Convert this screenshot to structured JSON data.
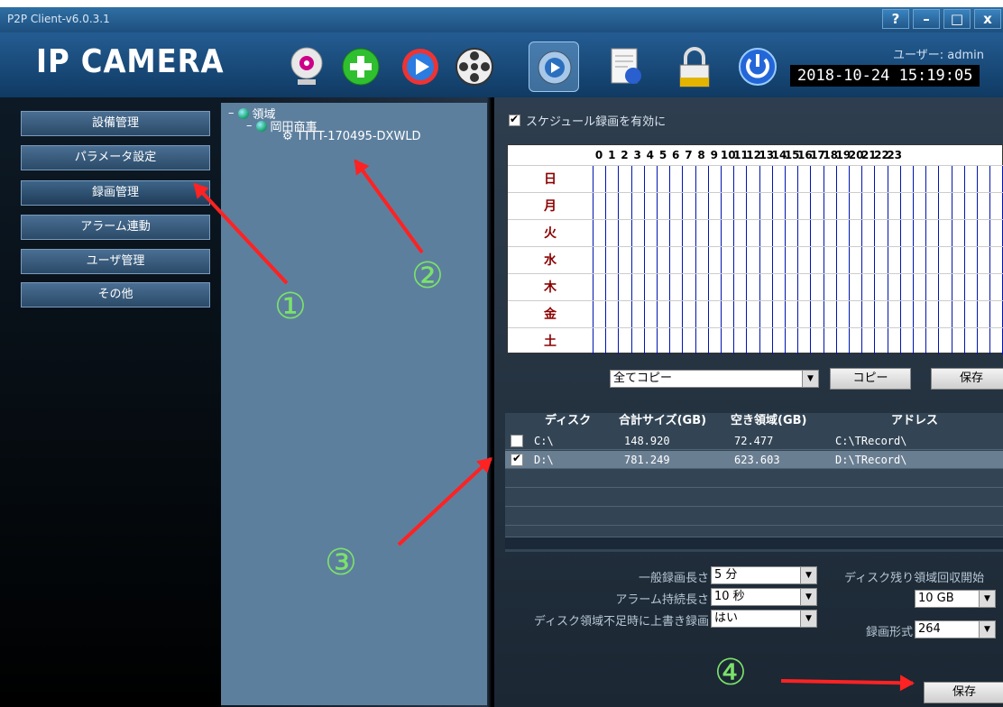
{
  "window": {
    "title": "P2P Client-v6.0.3.1",
    "btn_help": "?",
    "btn_min": "–",
    "btn_max": "□",
    "btn_close": "x"
  },
  "header": {
    "logo": "IP CAMERA",
    "user": "ユーザー: admin",
    "datetime": "2018-10-24  15:19:05",
    "toolbar": [
      "camera-icon",
      "add-icon",
      "play-icon",
      "film-reel-icon",
      "settings-icon",
      "log-icon",
      "lock-icon",
      "power-icon"
    ]
  },
  "nav": {
    "items": [
      "設備管理",
      "パラメータ設定",
      "録画管理",
      "アラーム連動",
      "ユーザ管理",
      "その他"
    ],
    "selected": 2
  },
  "tree": {
    "root": "領域",
    "group": "岡田商事",
    "device": "TTTT-170495-DXWLD"
  },
  "schedule": {
    "enable_label": "スケジュール録画を有効に",
    "enabled": true,
    "hours": [
      "0",
      "1",
      "2",
      "3",
      "4",
      "5",
      "6",
      "7",
      "8",
      "9",
      "10",
      "11",
      "12",
      "13",
      "14",
      "15",
      "16",
      "17",
      "18",
      "19",
      "20",
      "21",
      "22",
      "23"
    ],
    "days": [
      "日",
      "月",
      "火",
      "水",
      "木",
      "金",
      "土"
    ],
    "copy_select": "全てコピー",
    "copy_button": "コピー",
    "save_button": "保存"
  },
  "disks": {
    "headers": [
      "ディスク",
      "合計サイズ(GB)",
      "空き領域(GB)",
      "アドレス"
    ],
    "rows": [
      {
        "checked": false,
        "disk": "C:\\",
        "total": "148.920",
        "free": "72.477",
        "address": "C:\\TRecord\\"
      },
      {
        "checked": true,
        "disk": "D:\\",
        "total": "781.249",
        "free": "623.603",
        "address": "D:\\TRecord\\"
      }
    ]
  },
  "settings": {
    "normal_len_label": "一般録画長さ",
    "normal_len_value": "5 分",
    "alarm_len_label": "アラーム持続長さ",
    "alarm_len_value": "10 秒",
    "overwrite_label": "ディスク領域不足時に上書き録画",
    "overwrite_value": "はい",
    "reclaim_label": "ディスク残り領域回収開始",
    "reclaim_value": "10 GB",
    "format_label": "録画形式",
    "format_value": "264",
    "save_button": "保存"
  },
  "annotations": {
    "n1": "①",
    "n2": "②",
    "n3": "③",
    "n4": "④",
    "arrow_color": "#ff2020",
    "number_color": "#7be26a"
  }
}
